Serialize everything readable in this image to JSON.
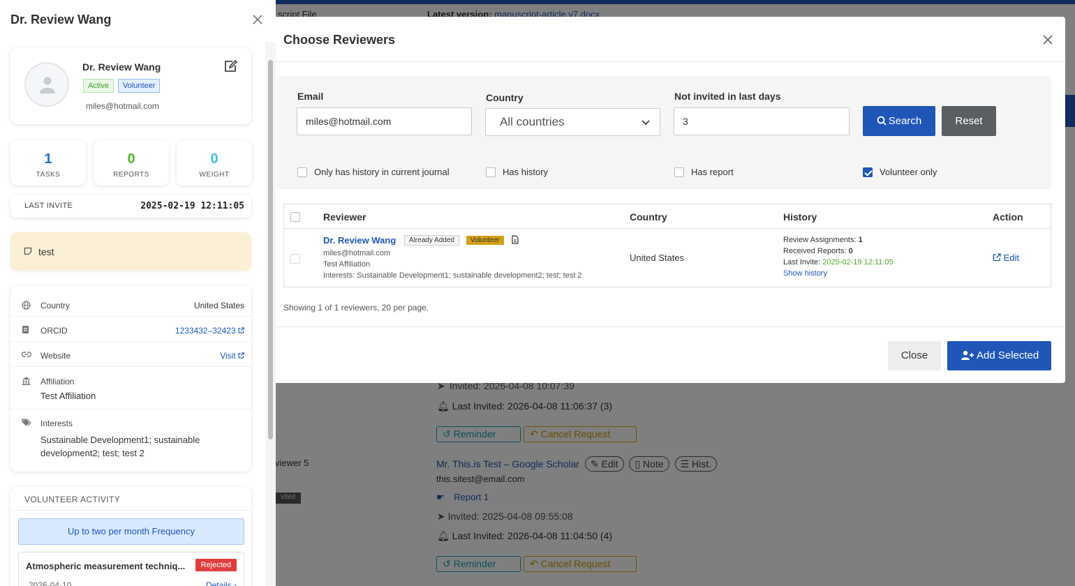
{
  "background": {
    "file_label": "script File",
    "latest_version_label": "Latest version:",
    "latest_version_file": "manuscript-article.v7.docx",
    "reviewer_label": "viewer 5",
    "badge": "vited",
    "entry1": {
      "invited": "Invited: 2026-04-08 10:07:39",
      "last_invited": "Last Invited: 2026-04-08 11:06:37 (3)",
      "reminder": "Reminder",
      "cancel": "Cancel Request"
    },
    "entry2": {
      "name": "Mr. This.is Test – Google Scholar",
      "edit": "Edit",
      "note": "Note",
      "hist": "Hist.",
      "email": "this.sitest@email.com",
      "report": "Report 1",
      "invited": "Invited: 2025-04-08 09:55:08",
      "last_invited": "Last Invited: 2026-04-08 11:04:50 (4)",
      "reminder": "Reminder",
      "cancel": "Cancel Request"
    }
  },
  "modal": {
    "title": "Choose Reviewers",
    "filters": {
      "email_label": "Email",
      "email_value": "miles@hotmail.com",
      "country_label": "Country",
      "country_value": "All countries",
      "days_label": "Not invited in last days",
      "days_value": "3",
      "search": "Search",
      "reset": "Reset",
      "checkboxes": [
        {
          "label": "Only has history in current journal",
          "checked": false
        },
        {
          "label": "Has history",
          "checked": false
        },
        {
          "label": "Has report",
          "checked": false
        },
        {
          "label": "Volunteer only",
          "checked": true
        }
      ]
    },
    "table": {
      "headers": [
        "Reviewer",
        "Country",
        "History",
        "Action"
      ],
      "row": {
        "name": "Dr. Review Wang",
        "tag_added": "Already Added",
        "tag_volunteer": "Volunteer",
        "email": "miles@hotmail.com",
        "affiliation": "Test Affiliation",
        "interests": "Interests: Sustainable Development1; sustainable development2; test; test 2",
        "country": "United States",
        "assignments_label": "Review Assignments:",
        "assignments": "1",
        "reports_label": "Received Reports:",
        "reports": "0",
        "last_invite_label": "Last Invite:",
        "last_invite": "2025-02-19 12:11:05",
        "show_history": "Show history",
        "action": "Edit"
      }
    },
    "summary": "Showing 1 of 1 reviewers, 20 per page.",
    "close": "Close",
    "add_selected": "Add Selected"
  },
  "panel": {
    "title": "Dr. Review Wang",
    "profile": {
      "name": "Dr. Review Wang",
      "badge_active": "Active",
      "badge_volunteer": "Volunteer",
      "email": "miles@hotmail.com"
    },
    "stats": [
      {
        "value": "1",
        "label": "TASKS",
        "color": "#1f6fd1"
      },
      {
        "value": "0",
        "label": "REPORTS",
        "color": "#52b830"
      },
      {
        "value": "0",
        "label": "WEIGHT",
        "color": "#3fc1e0"
      }
    ],
    "last_invite_label": "LAST INVITE",
    "last_invite_value": "2025-02-19 12:11:05",
    "note": "test",
    "info": {
      "country_label": "Country",
      "country_value": "United States",
      "orcid_label": "ORCID",
      "orcid_value": "1233432–32423",
      "website_label": "Website",
      "website_value": "Visit",
      "affiliation_label": "Affiliation",
      "affiliation_value": "Test Affiliation",
      "interests_label": "Interests",
      "interests_line1": "Sustainable Development1; sustainable",
      "interests_line2": "development2; test; test 2"
    },
    "volunteer": {
      "title": "VOLUNTEER ACTIVITY",
      "frequency": "Up to two per month Frequency",
      "item_title": "Atmospheric measurement techniq...",
      "item_status": "Rejected",
      "item_date": "2026-04-10",
      "item_details": "Details"
    }
  }
}
